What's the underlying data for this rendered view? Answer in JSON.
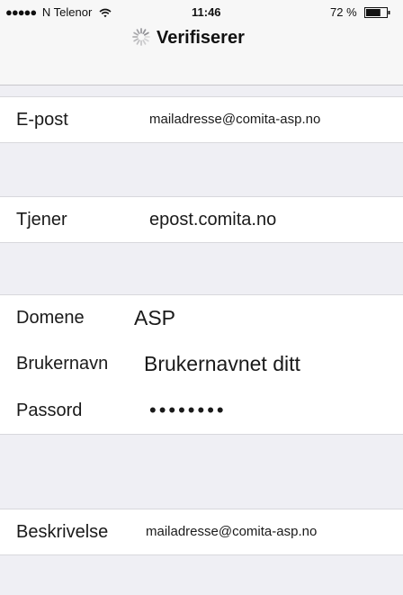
{
  "status_bar": {
    "signal_dots": "●●●●●",
    "carrier": "N Telenor",
    "wifi_icon": "wifi-icon",
    "time": "11:46",
    "battery_percent": "72 %",
    "battery_level": 0.72
  },
  "nav": {
    "spinner_icon": "activity-spinner-icon",
    "title": "Verifiserer"
  },
  "form": {
    "email": {
      "label": "E-post",
      "value": "mailadresse@comita-asp.no"
    },
    "server": {
      "label": "Tjener",
      "value": "epost.comita.no"
    },
    "domain": {
      "label": "Domene",
      "value": "ASP"
    },
    "username": {
      "label": "Brukernavn",
      "value": "Brukernavnet ditt"
    },
    "password": {
      "label": "Passord",
      "value": "••••••••"
    },
    "description": {
      "label": "Beskrivelse",
      "value": "mailadresse@comita-asp.no"
    }
  }
}
